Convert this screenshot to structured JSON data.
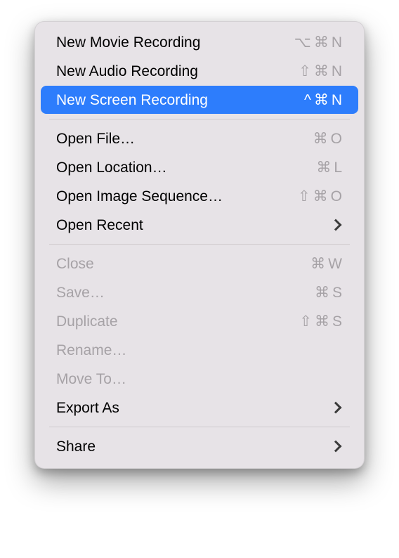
{
  "menu": {
    "groups": [
      [
        {
          "id": "new-movie",
          "label": "New Movie Recording",
          "shortcut": [
            "⌥",
            "⌘",
            "N"
          ],
          "disabled": false,
          "highlight": false,
          "submenu": false
        },
        {
          "id": "new-audio",
          "label": "New Audio Recording",
          "shortcut": [
            "⇧",
            "⌘",
            "N"
          ],
          "disabled": false,
          "highlight": false,
          "submenu": false
        },
        {
          "id": "new-screen",
          "label": "New Screen Recording",
          "shortcut": [
            "^",
            "⌘",
            "N"
          ],
          "disabled": false,
          "highlight": true,
          "submenu": false
        }
      ],
      [
        {
          "id": "open-file",
          "label": "Open File…",
          "shortcut": [
            "⌘",
            "O"
          ],
          "disabled": false,
          "highlight": false,
          "submenu": false
        },
        {
          "id": "open-loc",
          "label": "Open Location…",
          "shortcut": [
            "⌘",
            "L"
          ],
          "disabled": false,
          "highlight": false,
          "submenu": false
        },
        {
          "id": "open-imgseq",
          "label": "Open Image Sequence…",
          "shortcut": [
            "⇧",
            "⌘",
            "O"
          ],
          "disabled": false,
          "highlight": false,
          "submenu": false
        },
        {
          "id": "open-recent",
          "label": "Open Recent",
          "shortcut": [],
          "disabled": false,
          "highlight": false,
          "submenu": true
        }
      ],
      [
        {
          "id": "close",
          "label": "Close",
          "shortcut": [
            "⌘",
            "W"
          ],
          "disabled": true,
          "highlight": false,
          "submenu": false
        },
        {
          "id": "save",
          "label": "Save…",
          "shortcut": [
            "⌘",
            "S"
          ],
          "disabled": true,
          "highlight": false,
          "submenu": false
        },
        {
          "id": "duplicate",
          "label": "Duplicate",
          "shortcut": [
            "⇧",
            "⌘",
            "S"
          ],
          "disabled": true,
          "highlight": false,
          "submenu": false
        },
        {
          "id": "rename",
          "label": "Rename…",
          "shortcut": [],
          "disabled": true,
          "highlight": false,
          "submenu": false
        },
        {
          "id": "move-to",
          "label": "Move To…",
          "shortcut": [],
          "disabled": true,
          "highlight": false,
          "submenu": false
        },
        {
          "id": "export-as",
          "label": "Export As",
          "shortcut": [],
          "disabled": false,
          "highlight": false,
          "submenu": true
        }
      ],
      [
        {
          "id": "share",
          "label": "Share",
          "shortcut": [],
          "disabled": false,
          "highlight": false,
          "submenu": true
        }
      ]
    ]
  }
}
